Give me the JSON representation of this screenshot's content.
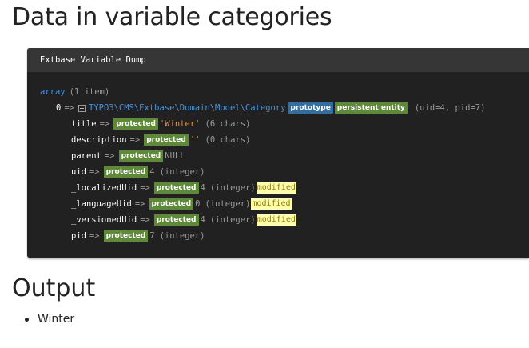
{
  "page": {
    "title": "Data in variable categories",
    "output_heading": "Output"
  },
  "dump": {
    "header": "Extbase Variable Dump",
    "root_type": "array",
    "root_meta": "(1 item)",
    "entry_key": "0",
    "arrow": "=>",
    "class_name": "TYPO3\\CMS\\Extbase\\Domain\\Model\\Category",
    "badge_prototype": "prototype",
    "badge_persistent": "persistent entity",
    "entry_meta": "(uid=4, pid=7)",
    "protected_label": "protected",
    "modified_label": "modified",
    "properties": [
      {
        "name": "title",
        "value": "'Winter'",
        "meta": "(6 chars)",
        "value_kind": "string",
        "modified": false
      },
      {
        "name": "description",
        "value": "''",
        "meta": "(0 chars)",
        "value_kind": "string",
        "modified": false
      },
      {
        "name": "parent",
        "value": "NULL",
        "meta": "",
        "value_kind": "null",
        "modified": false
      },
      {
        "name": "uid",
        "value": "4",
        "meta": "(integer)",
        "value_kind": "number",
        "modified": false
      },
      {
        "name": "_localizedUid",
        "value": "4",
        "meta": "(integer)",
        "value_kind": "number",
        "modified": true
      },
      {
        "name": "_languageUid",
        "value": "0",
        "meta": "(integer)",
        "value_kind": "number",
        "modified": true
      },
      {
        "name": "_versionedUid",
        "value": "4",
        "meta": "(integer)",
        "value_kind": "number",
        "modified": true
      },
      {
        "name": "pid",
        "value": "7",
        "meta": "(integer)",
        "value_kind": "number",
        "modified": false
      }
    ]
  },
  "output": {
    "items": [
      "Winter"
    ]
  },
  "colors": {
    "dump_background": "#212121",
    "dump_header": "#363636",
    "protected_badge": "#5b8b33",
    "prototype_badge": "#2f6fa8",
    "modified_badge": "#ffffaa",
    "string_value": "#d99858",
    "type_blue": "#4e92d1"
  }
}
